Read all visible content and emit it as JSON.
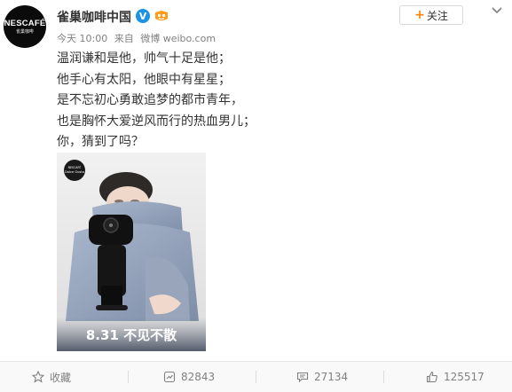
{
  "post": {
    "author": "雀巢咖啡中国",
    "time": "今天 10:00",
    "source_prefix": "来自",
    "source": "微博 weibo.com",
    "follow_label": "关注",
    "lines": [
      "温润谦和是他，帅气十足是他；",
      "他手心有太阳，他眼中有星星；",
      "是不忘初心勇敢追梦的都市青年，",
      "也是胸怀大爱逆风而行的热血男儿；",
      "你，猜到了吗？"
    ],
    "image": {
      "badge_text": "NESCAFÉ Dolce Gusto",
      "caption": "8.31 不见不散"
    }
  },
  "avatar": {
    "brand": "NESCAFÉ",
    "sub": "雀巢咖啡"
  },
  "actions": {
    "favorite": "收藏",
    "repost": "82843",
    "comment": "27134",
    "like": "125517"
  },
  "colors": {
    "accent": "#ff8200",
    "verified": "#1a93e6",
    "text": "#333333",
    "meta": "#808080"
  },
  "icons": [
    "verified-icon",
    "vip-icon",
    "plus-icon",
    "chevron-down-icon",
    "star-icon",
    "repost-icon",
    "comment-icon",
    "like-icon"
  ]
}
